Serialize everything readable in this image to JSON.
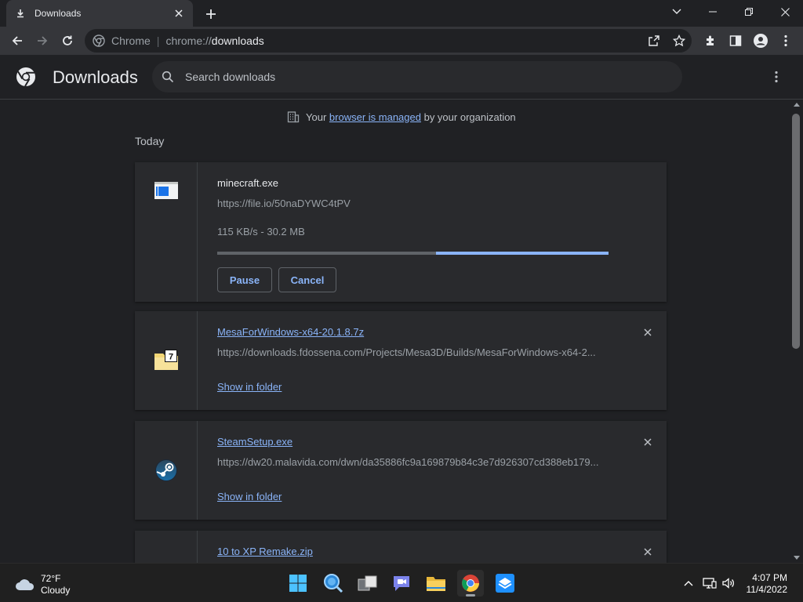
{
  "tab": {
    "title": "Downloads"
  },
  "omnibox": {
    "site_name": "Chrome",
    "url_scheme": "chrome://",
    "url_host": "downloads"
  },
  "header": {
    "title": "Downloads",
    "search_placeholder": "Search downloads"
  },
  "managed_notice": {
    "prefix": "Your",
    "link": "browser is managed",
    "suffix": "by your organization"
  },
  "section_label": "Today",
  "downloads": [
    {
      "name": "minecraft.exe",
      "url": "https://file.io/50naDYWC4tPV",
      "status": "115 KB/s - 30.2 MB",
      "progress": 0.44,
      "buttons": {
        "pause": "Pause",
        "cancel": "Cancel"
      }
    },
    {
      "name": "MesaForWindows-x64-20.1.8.7z",
      "url": "https://downloads.fdossena.com/Projects/Mesa3D/Builds/MesaForWindows-x64-2...",
      "action": "Show in folder"
    },
    {
      "name": "SteamSetup.exe",
      "url": "https://dw20.malavida.com/dwn/da35886fc9a169879b84c3e7d926307cd388eb179...",
      "action": "Show in folder"
    },
    {
      "name": "10 to XP Remake.zip"
    }
  ],
  "taskbar": {
    "weather": {
      "temp": "72°F",
      "condition": "Cloudy"
    },
    "clock": {
      "time": "4:07 PM",
      "date": "11/4/2022"
    }
  },
  "colors": {
    "accent": "#8ab4f8",
    "background": "#202124",
    "card": "#292a2d"
  }
}
